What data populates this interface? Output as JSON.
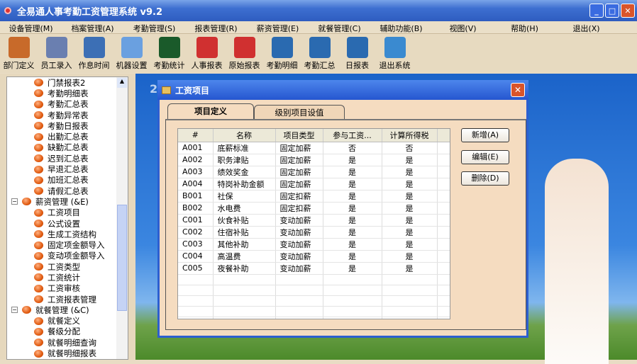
{
  "app": {
    "title": "全易通人事考勤工资管理系统 v9.2"
  },
  "menu": [
    "设备管理(M)",
    "档案管理(A)",
    "考勤管理(S)",
    "报表管理(R)",
    "薪资管理(E)",
    "就餐管理(C)",
    "辅助功能(B)",
    "视图(V)",
    "帮助(H)",
    "退出(X)"
  ],
  "toolbar": [
    {
      "label": "部门定义",
      "icon": "users-icon",
      "color": "#c86a2a"
    },
    {
      "label": "员工录入",
      "icon": "employee-icon",
      "color": "#6a7fb0"
    },
    {
      "label": "作息时间",
      "icon": "clock-icon",
      "color": "#3c6fb5"
    },
    {
      "label": "机器设置",
      "icon": "computer-icon",
      "color": "#6aa0e0"
    },
    {
      "label": "考勤统计",
      "icon": "waveform-icon",
      "color": "#1a5a2a"
    },
    {
      "label": "人事报表",
      "icon": "report-a-icon",
      "color": "#d03030"
    },
    {
      "label": "原始报表",
      "icon": "report-a-icon",
      "color": "#d03030"
    },
    {
      "label": "考勤明细",
      "icon": "report-t-icon",
      "color": "#2a6ab0"
    },
    {
      "label": "考勤汇总",
      "icon": "report-t-icon",
      "color": "#2a6ab0"
    },
    {
      "label": "日报表",
      "icon": "report-t-icon",
      "color": "#2a6ab0"
    },
    {
      "label": "退出系统",
      "icon": "exit-icon",
      "color": "#3a8ad0"
    }
  ],
  "tree": {
    "group1_items": [
      "门禁报表2",
      "考勤明细表",
      "考勤汇总表",
      "考勤异常表",
      "考勤日报表",
      "出勤汇总表",
      "缺勤汇总表",
      "迟到汇总表",
      "早退汇总表",
      "加班汇总表",
      "请假汇总表"
    ],
    "group2": {
      "label": "薪资管理 (&E)",
      "items": [
        "工资项目",
        "公式设置",
        "生成工资结构",
        "固定项金额导入",
        "变动项金额导入",
        "工资类型",
        "工资统计",
        "工资审核",
        "工资报表管理"
      ]
    },
    "group3": {
      "label": "就餐管理 (&C)",
      "items": [
        "就餐定义",
        "餐级分配",
        "就餐明细查询",
        "就餐明细报表"
      ]
    }
  },
  "dialog": {
    "title": "工资项目",
    "tabs": [
      "项目定义",
      "级别项目设值"
    ],
    "columns": [
      "#",
      "名称",
      "项目类型",
      "参与工资...",
      "计算所得税"
    ],
    "rows": [
      [
        "A001",
        "底薪标准",
        "固定加薪",
        "否",
        "否"
      ],
      [
        "A002",
        "职务津贴",
        "固定加薪",
        "是",
        "是"
      ],
      [
        "A003",
        "绩效奖金",
        "固定加薪",
        "是",
        "是"
      ],
      [
        "A004",
        "特岗补助金额",
        "固定加薪",
        "是",
        "是"
      ],
      [
        "B001",
        "社保",
        "固定扣薪",
        "是",
        "是"
      ],
      [
        "B002",
        "水电费",
        "固定扣薪",
        "是",
        "是"
      ],
      [
        "C001",
        "伙食补贴",
        "变动加薪",
        "是",
        "是"
      ],
      [
        "C002",
        "住宿补贴",
        "变动加薪",
        "是",
        "是"
      ],
      [
        "C003",
        "其他补助",
        "变动加薪",
        "是",
        "是"
      ],
      [
        "C004",
        "高温费",
        "变动加薪",
        "是",
        "是"
      ],
      [
        "C005",
        "夜餐补助",
        "变动加薪",
        "是",
        "是"
      ]
    ],
    "buttons": {
      "add": "新增(A)",
      "edit": "编辑(E)",
      "delete": "删除(D)"
    }
  },
  "background_text": "2"
}
